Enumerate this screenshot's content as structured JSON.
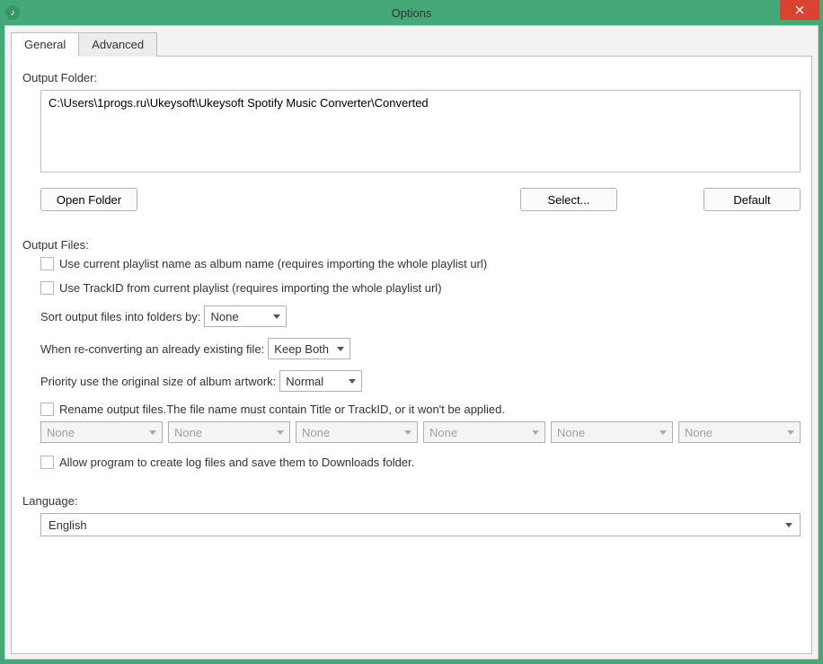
{
  "window": {
    "title": "Options",
    "close_label": "Close"
  },
  "tabs": {
    "general": "General",
    "advanced": "Advanced"
  },
  "output_folder": {
    "label": "Output Folder:",
    "path": "C:\\Users\\1progs.ru\\Ukeysoft\\Ukeysoft Spotify Music Converter\\Converted",
    "open_folder": "Open Folder",
    "select": "Select...",
    "default": "Default"
  },
  "output_files": {
    "label": "Output Files:",
    "use_playlist_name": "Use current playlist name as album name (requires importing the whole playlist url)",
    "use_trackid": "Use TrackID from current playlist (requires importing the whole playlist url)",
    "sort_label": "Sort output files into folders by:",
    "sort_value": "None",
    "reconvert_label": "When re-converting an already existing file:",
    "reconvert_value": "Keep Both",
    "artwork_label": "Priority use the original size of album artwork:",
    "artwork_value": "Normal",
    "rename_label": "Rename output files.The file name must contain Title or TrackID, or it won't be applied.",
    "rename_values": [
      "None",
      "None",
      "None",
      "None",
      "None",
      "None"
    ],
    "log_label": "Allow program to create log files and save them to Downloads folder."
  },
  "language": {
    "label": "Language:",
    "value": "English"
  }
}
